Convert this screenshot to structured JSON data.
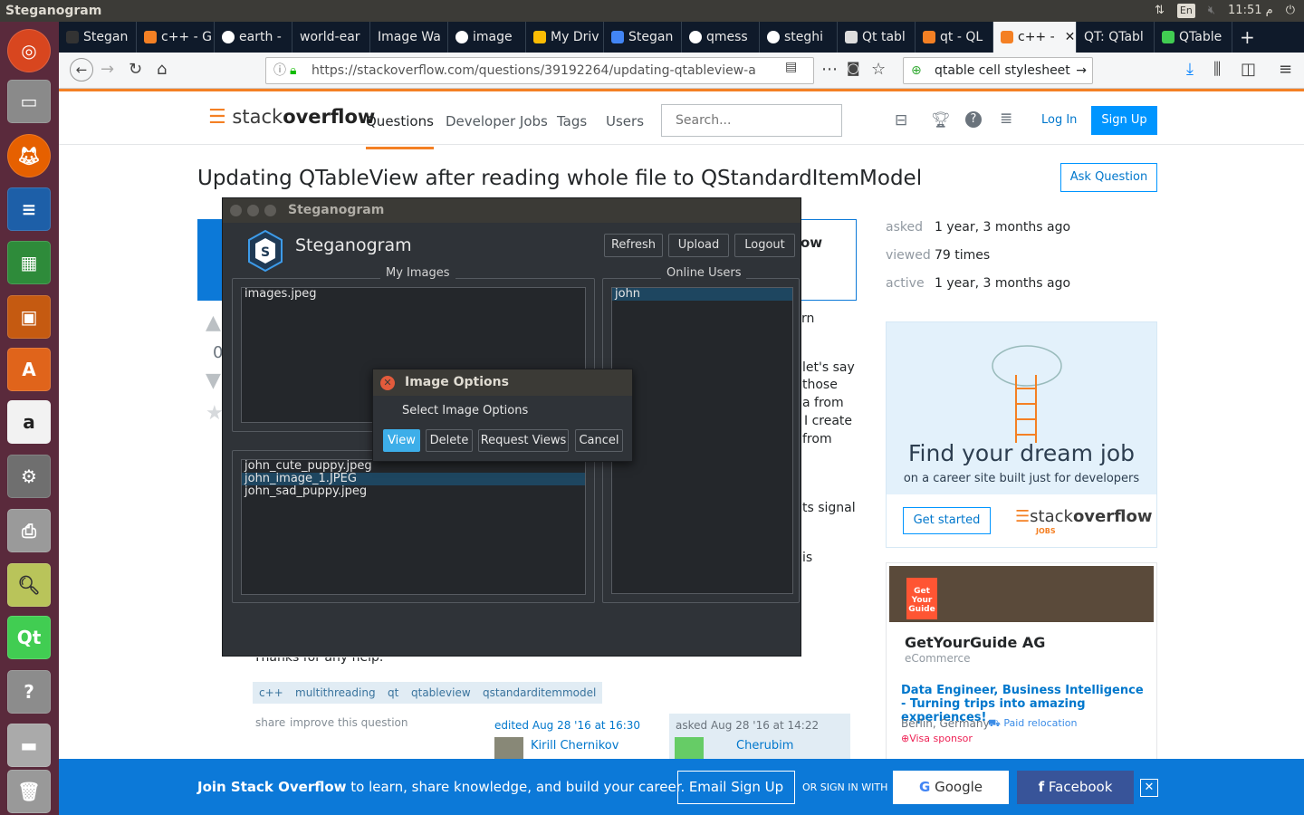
{
  "topbar": {
    "title": "Steganogram",
    "keyboard": "En",
    "time": "11:51 م"
  },
  "browser": {
    "tabs": [
      "Stegan",
      "c++ - G",
      "earth -",
      "world-ear",
      "Image Wa",
      "image",
      "My Driv",
      "Stegan",
      "qmess",
      "steghi",
      "Qt tabl",
      "qt - QL",
      "c++ -",
      "QT: QTabl",
      "QTable"
    ],
    "url": "https://stackoverflow.com/questions/39192264/updating-qtableview-a",
    "search": "qtable cell stylesheet"
  },
  "so": {
    "logo_a": "stack",
    "logo_b": "overflow",
    "nav": [
      "Questions",
      "Developer Jobs",
      "Tags",
      "Users"
    ],
    "search_placeholder": "Search...",
    "login": "Log In",
    "signup": "Sign Up",
    "question_title": "Updating QTableView after reading whole file to QStandardItemModel",
    "ask": "Ask Question",
    "stats": [
      {
        "label": "asked",
        "value": "1 year, 3 months ago"
      },
      {
        "label": "viewed",
        "value": "79 times"
      },
      {
        "label": "active",
        "value": "1 year, 3 months ago"
      }
    ],
    "vote_count": "0",
    "body_fragments": [
      "rn",
      "let's say",
      "those",
      "a from",
      "I create",
      "from",
      "ts signal",
      "is",
      "Thanks for any help."
    ],
    "tags": [
      "c++",
      "multithreading",
      "qt",
      "qtableview",
      "qstandarditemmodel"
    ],
    "share": "share",
    "improve": "improve this question",
    "edited": "edited Aug 28 '16 at 16:30",
    "editor": "Kirill Chernikov",
    "asked_on": "asked Aug 28 '16 at 14:22",
    "asker": "Cherubim",
    "ad1": {
      "headline": "Find your dream job",
      "sub": "on a career site built just for developers",
      "cta": "Get started",
      "jobs": "JOBS"
    },
    "ad2": {
      "company": "GetYourGuide AG",
      "category": "eCommerce",
      "job": "Data Engineer, Business Intelligence - Turning trips into amazing experiences!",
      "location": "Berlin, Germany",
      "relocation": "Paid relocation",
      "visa": "Visa sponsor",
      "badge": "Get Your Guide"
    },
    "banner": {
      "strong": "Join Stack Overflow",
      "text": " to learn, share knowledge, and build your career.",
      "email": "Email Sign Up",
      "or": "OR SIGN IN WITH",
      "google": "Google",
      "facebook": "Facebook"
    }
  },
  "app": {
    "window_title": "Steganogram",
    "brand": "Steganogram",
    "buttons": {
      "refresh": "Refresh",
      "upload": "Upload",
      "logout": "Logout"
    },
    "my_images_label": "My Images",
    "my_images": [
      "images.jpeg"
    ],
    "online_users_label": "Online Users",
    "online_users": [
      "john"
    ],
    "user_images": [
      "john_cute_puppy.jpeg",
      "john_image_1.JPEG",
      "john_sad_puppy.jpeg"
    ]
  },
  "dialog": {
    "title": "Image Options",
    "prompt": "Select Image Options",
    "buttons": {
      "view": "View",
      "delete": "Delete",
      "request": "Request Views",
      "cancel": "Cancel"
    }
  }
}
